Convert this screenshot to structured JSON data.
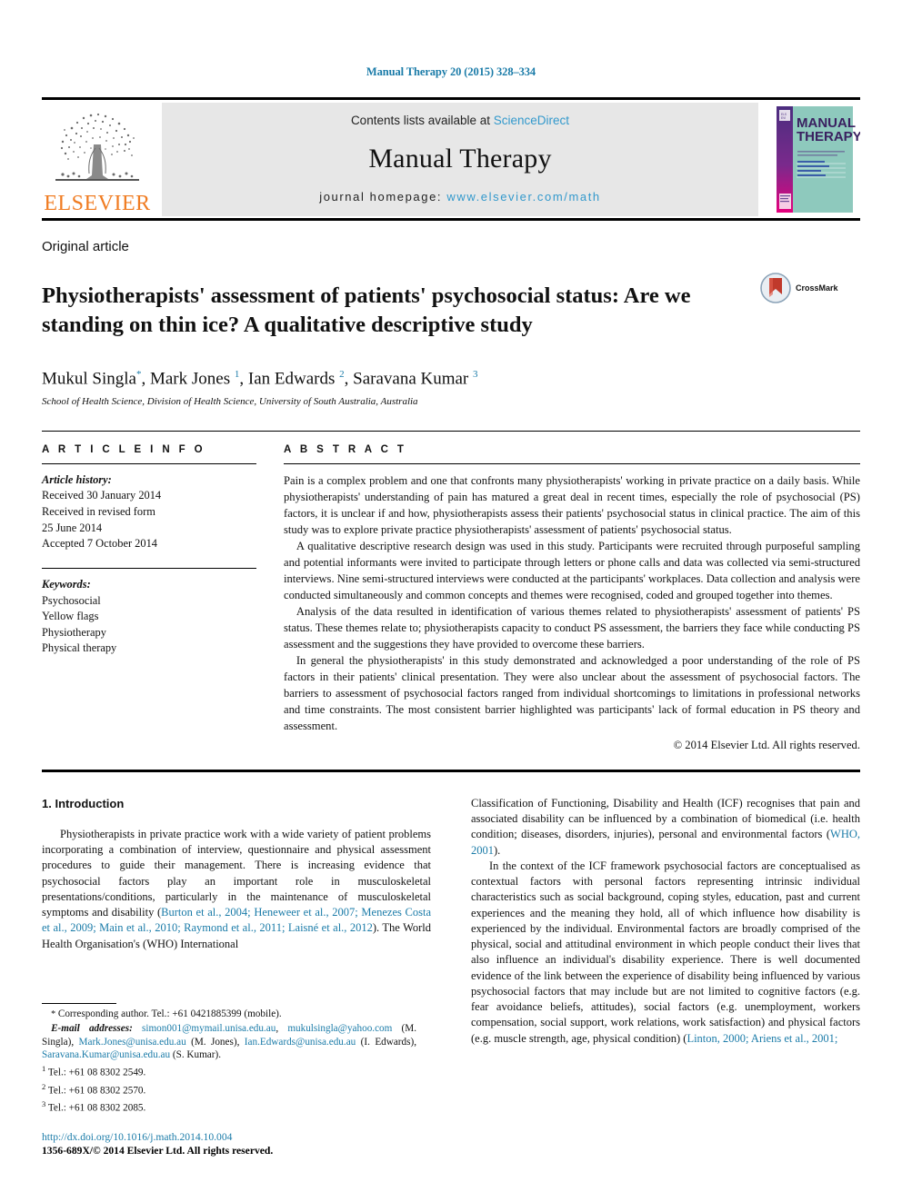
{
  "running_head": "Manual Therapy 20 (2015) 328–334",
  "masthead": {
    "publisher_name": "ELSEVIER",
    "contents_prefix": "Contents lists available at ",
    "contents_link": "ScienceDirect",
    "journal_name": "Manual Therapy",
    "homepage_prefix": "journal homepage: ",
    "homepage_url": "www.elsevier.com/math",
    "cover": {
      "line1": "MANUAL",
      "line2": "THERAPY",
      "subtitle": "OFFICIAL JOURNAL OF THE\nIFOMPT / MACP / MPA"
    }
  },
  "article": {
    "type": "Original article",
    "title": "Physiotherapists' assessment of patients' psychosocial status: Are we standing on thin ice? A qualitative descriptive study",
    "crossmark_label": "CrossMark",
    "authors_html": "Mukul Singla<sup>*</sup>, Mark Jones <sup>1</sup>, Ian Edwards <sup>2</sup>, Saravana Kumar <sup>3</sup>",
    "affiliation": "School of Health Science, Division of Health Science, University of South Australia, Australia"
  },
  "article_info": {
    "heading": "A R T I C L E   I N F O",
    "history_label": "Article history:",
    "history": [
      "Received 30 January 2014",
      "Received in revised form",
      "25 June 2014",
      "Accepted 7 October 2014"
    ],
    "keywords_label": "Keywords:",
    "keywords": [
      "Psychosocial",
      "Yellow flags",
      "Physiotherapy",
      "Physical therapy"
    ]
  },
  "abstract": {
    "heading": "A B S T R A C T",
    "paragraphs": [
      "Pain is a complex problem and one that confronts many physiotherapists' working in private practice on a daily basis. While physiotherapists' understanding of pain has matured a great deal in recent times, especially the role of psychosocial (PS) factors, it is unclear if and how, physiotherapists assess their patients' psychosocial status in clinical practice. The aim of this study was to explore private practice physiotherapists' assessment of patients' psychosocial status.",
      "A qualitative descriptive research design was used in this study. Participants were recruited through purposeful sampling and potential informants were invited to participate through letters or phone calls and data was collected via semi-structured interviews. Nine semi-structured interviews were conducted at the participants' workplaces. Data collection and analysis were conducted simultaneously and common concepts and themes were recognised, coded and grouped together into themes.",
      "Analysis of the data resulted in identification of various themes related to physiotherapists' assessment of patients' PS status. These themes relate to; physiotherapists capacity to conduct PS assessment, the barriers they face while conducting PS assessment and the suggestions they have provided to overcome these barriers.",
      "In general the physiotherapists' in this study demonstrated and acknowledged a poor understanding of the role of PS factors in their patients' clinical presentation. They were also unclear about the assessment of psychosocial factors. The barriers to assessment of psychosocial factors ranged from individual shortcomings to limitations in professional networks and time constraints. The most consistent barrier highlighted was participants' lack of formal education in PS theory and assessment."
    ],
    "copyright": "© 2014 Elsevier Ltd. All rights reserved."
  },
  "body": {
    "section_number_title": "1.  Introduction",
    "left_paragraph_html": "Physiotherapists in private practice work with a wide variety of patient problems incorporating a combination of interview, questionnaire and physical assessment procedures to guide their management. There is increasing evidence that psychosocial factors play an important role in musculoskeletal presentations/conditions, particularly in the maintenance of musculoskeletal symptoms and disability (<span class=\"ref\">Burton et al., 2004; Heneweer et al., 2007; Menezes Costa et al., 2009; Main et al., 2010; Raymond et al., 2011; Laisné et al., 2012</span>). The World Health Organisation's (WHO) International",
    "right_paragraph_1_html": "Classification of Functioning, Disability and Health (ICF) recognises that pain and associated disability can be influenced by a combination of biomedical (i.e. health condition; diseases, disorders, injuries), personal and environmental factors (<span class=\"ref\">WHO, 2001</span>).",
    "right_paragraph_2_html": "In the context of the ICF framework psychosocial factors are conceptualised as contextual factors with personal factors representing intrinsic individual characteristics such as social background, coping styles, education, past and current experiences and the meaning they hold, all of which influence how disability is experienced by the individual. Environmental factors are broadly comprised of the physical, social and attitudinal environment in which people conduct their lives that also influence an individual's disability experience. There is well documented evidence of the link between the experience of disability being influenced by various psychosocial factors that may include but are not limited to cognitive factors (e.g. fear avoidance beliefs, attitudes), social factors (e.g. unemployment, workers compensation, social support, work relations, work satisfaction) and physical factors (e.g. muscle strength, age, physical condition) (<span class=\"ref\">Linton, 2000; Ariens et al., 2001;</span>"
  },
  "footnotes": {
    "corresponding_html": "<span class=\"star\">*</span> Corresponding author. Tel.: +61 0421885399 (mobile).",
    "emails_html": "<i><b>E-mail addresses:</b></i> <span class=\"ref\">simon001@mymail.unisa.edu.au</span>, <span class=\"ref\">mukulsingla@yahoo.com</span> (M. Singla), <span class=\"ref\">Mark.Jones@unisa.edu.au</span> (M. Jones), <span class=\"ref\">Ian.Edwards@unisa.edu.au</span> (I. Edwards), <span class=\"ref\">Saravana.Kumar@unisa.edu.au</span> (S. Kumar).",
    "tels": [
      {
        "sup": "1",
        "text": "Tel.: +61 08 8302 2549."
      },
      {
        "sup": "2",
        "text": "Tel.: +61 08 8302 2570."
      },
      {
        "sup": "3",
        "text": "Tel.: +61 08 8302 2085."
      }
    ],
    "doi": "http://dx.doi.org/10.1016/j.math.2014.10.004",
    "issn_line": "1356-689X/© 2014 Elsevier Ltd. All rights reserved."
  },
  "colors": {
    "link_blue": "#1a7ba8",
    "sciencedirect_blue": "#3399cc",
    "elsevier_orange": "#f07c22",
    "masthead_gray": "#e7e7e7",
    "cover_teal": "#7fc4b8",
    "cover_purple": "#5b2d82",
    "cover_magenta": "#d4007f",
    "crossmark_red": "#c0392b"
  }
}
